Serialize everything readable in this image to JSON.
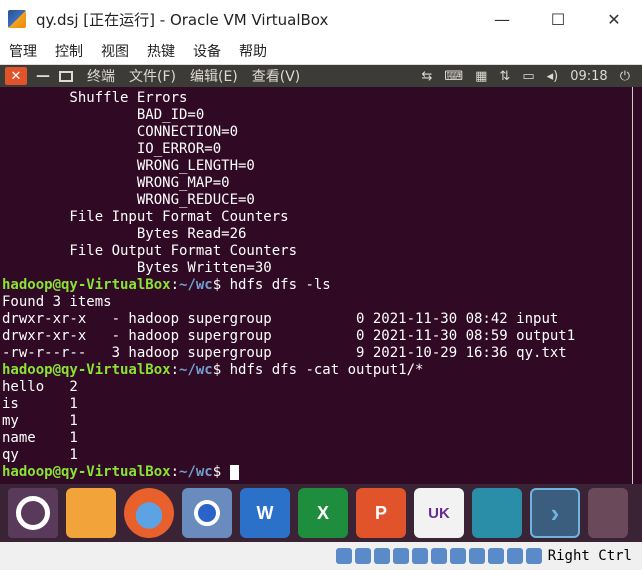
{
  "window": {
    "title": "qy.dsj [正在运行] - Oracle VM VirtualBox",
    "minimize_glyph": "—",
    "maximize_glyph": "☐",
    "close_glyph": "✕"
  },
  "vbox_menu": {
    "items": [
      "管理",
      "控制",
      "视图",
      "热键",
      "设备",
      "帮助"
    ]
  },
  "ubuntu_panel": {
    "close_glyph": "✕",
    "min_glyph": "—",
    "menus": [
      "终端",
      "文件(F)",
      "编辑(E)",
      "查看(V)"
    ],
    "clock": "09:18",
    "indicators": [
      "network-icon",
      "keyboard-icon",
      "calendar-icon",
      "transfer-icon",
      "battery-icon",
      "volume-icon",
      "power-icon"
    ]
  },
  "terminal": {
    "lines": [
      {
        "text": "        Shuffle Errors"
      },
      {
        "text": "                BAD_ID=0"
      },
      {
        "text": "                CONNECTION=0"
      },
      {
        "text": "                IO_ERROR=0"
      },
      {
        "text": "                WRONG_LENGTH=0"
      },
      {
        "text": "                WRONG_MAP=0"
      },
      {
        "text": "                WRONG_REDUCE=0"
      },
      {
        "text": "        File Input Format Counters"
      },
      {
        "text": "                Bytes Read=26"
      },
      {
        "text": "        File Output Format Counters"
      },
      {
        "text": "                Bytes Written=30"
      }
    ],
    "prompt_user": "hadoop@qy-VirtualBox",
    "prompt_sep": ":",
    "prompt_path": "~/wc",
    "prompt_end": "$ ",
    "cmd1": "hdfs dfs -ls",
    "ls_output": [
      "Found 3 items",
      "drwxr-xr-x   - hadoop supergroup          0 2021-11-30 08:42 input",
      "drwxr-xr-x   - hadoop supergroup          0 2021-11-30 08:59 output1",
      "-rw-r--r--   3 hadoop supergroup          9 2021-10-29 16:36 qy.txt"
    ],
    "cmd2": "hdfs dfs -cat output1/*",
    "cat_output": [
      "hello   2",
      "is      1",
      "my      1",
      "name    1",
      "qy      1"
    ]
  },
  "dock": {
    "items": [
      "ubuntu-icon",
      "files-icon",
      "firefox-icon",
      "chrome-icon",
      "word-icon",
      "excel-icon",
      "powerpoint-icon",
      "uk-icon",
      "bot-icon",
      "terminal-icon",
      "more-icon"
    ],
    "word_letter": "W",
    "excel_letter": "X",
    "ppt_letter": "P",
    "uk_label": "UK",
    "terminal_glyph": "›"
  },
  "status_bar": {
    "host_key": "Right Ctrl"
  }
}
